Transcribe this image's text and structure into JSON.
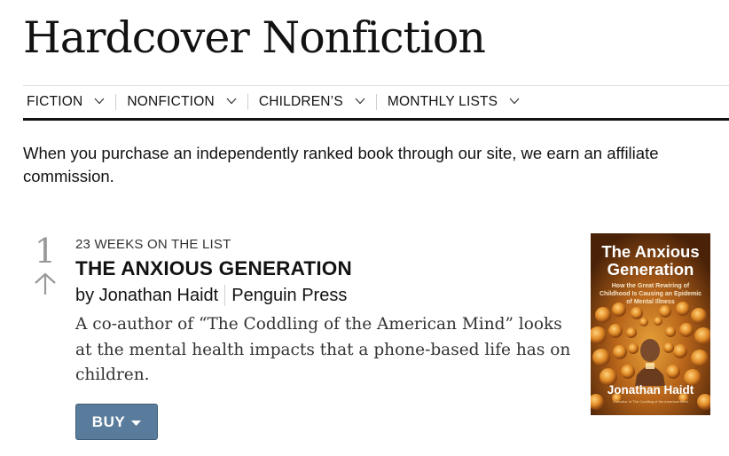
{
  "page": {
    "title": "Hardcover Nonfiction"
  },
  "nav": {
    "items": [
      {
        "label": "FICTION"
      },
      {
        "label": "NONFICTION"
      },
      {
        "label": "CHILDREN’S"
      },
      {
        "label": "MONTHLY LISTS"
      }
    ]
  },
  "disclaimer": "When you purchase an independently ranked book through our site, we earn an affiliate commission.",
  "book": {
    "rank": "1",
    "rank_trend_icon": "arrow-up-icon",
    "weeks_on_list": "23 WEEKS ON THE LIST",
    "title": "THE ANXIOUS GENERATION",
    "author": "by Jonathan Haidt",
    "publisher": "Penguin Press",
    "description": "A co-author of “The Coddling of the American Mind” looks at the mental health impacts that a phone-based life has on children.",
    "buy_label": "BUY",
    "cover": {
      "title_line1": "The Anxious",
      "title_line2": "Generation",
      "subtitle": "How the Great Rewiring of Childhood Is Causing an Epidemic of Mental Illness",
      "author": "Jonathan Haidt",
      "tagline": "Coauthor of The Coddling of the American Mind"
    }
  },
  "colors": {
    "buy_button": "#5a7c9c",
    "rank_number": "#999999",
    "cover_background": "#5a2e0d"
  }
}
